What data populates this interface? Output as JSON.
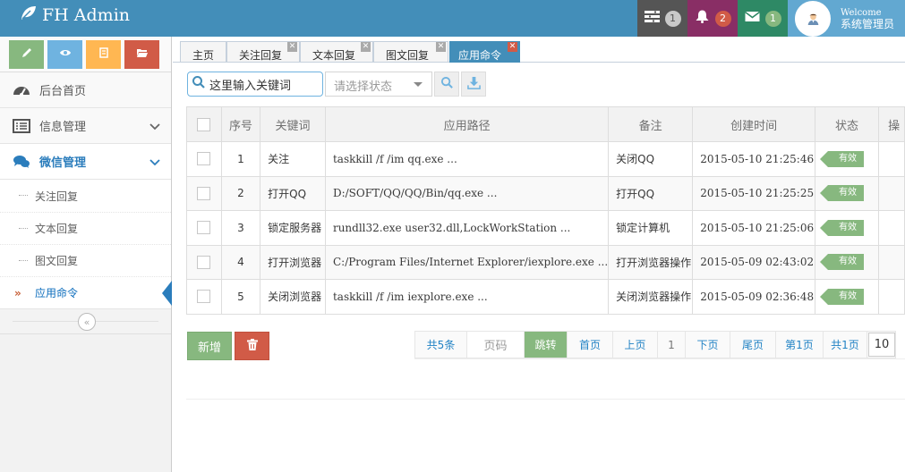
{
  "app": {
    "brand": "FH Admin"
  },
  "navbar": {
    "tasks_count": "1",
    "notifications_count": "2",
    "messages_count": "1",
    "welcome": "Welcome",
    "username": "系统管理员"
  },
  "sidebar": {
    "menu": [
      {
        "label": "后台首页",
        "icon": "tachometer-icon"
      },
      {
        "label": "信息管理",
        "icon": "list-alt-icon"
      },
      {
        "label": "微信管理",
        "icon": "comments-icon"
      }
    ],
    "submenu": [
      {
        "label": "关注回复"
      },
      {
        "label": "文本回复"
      },
      {
        "label": "图文回复"
      },
      {
        "label": "应用命令",
        "active": true
      }
    ],
    "collapse_glyph": "«"
  },
  "tabs": [
    {
      "label": "主页",
      "closable": false
    },
    {
      "label": "关注回复",
      "closable": true
    },
    {
      "label": "文本回复",
      "closable": true
    },
    {
      "label": "图文回复",
      "closable": true
    },
    {
      "label": "应用命令",
      "closable": true,
      "active": true
    }
  ],
  "toolbar": {
    "search_placeholder": "这里输入关键词",
    "status_placeholder": "请选择状态"
  },
  "table": {
    "headers": [
      "序号",
      "关键词",
      "应用路径",
      "备注",
      "创建时间",
      "状态",
      "操"
    ],
    "rows": [
      {
        "no": "1",
        "keyword": "关注",
        "path": "taskkill /f /im qq.exe ...",
        "note": "关闭QQ",
        "created": "2015-05-10 21:25:46",
        "status": "有效"
      },
      {
        "no": "2",
        "keyword": "打开QQ",
        "path": "D:/SOFT/QQ/QQ/Bin/qq.exe ...",
        "note": "打开QQ",
        "created": "2015-05-10 21:25:25",
        "status": "有效"
      },
      {
        "no": "3",
        "keyword": "锁定服务器",
        "path": "rundll32.exe user32.dll,LockWorkStation ...",
        "note": "锁定计算机",
        "created": "2015-05-10 21:25:06",
        "status": "有效"
      },
      {
        "no": "4",
        "keyword": "打开浏览器",
        "path": "C:/Program Files/Internet Explorer/iexplore.exe ...",
        "note": "打开浏览器操作",
        "created": "2015-05-09 02:43:02",
        "status": "有效"
      },
      {
        "no": "5",
        "keyword": "关闭浏览器",
        "path": "taskkill /f /im iexplore.exe ...",
        "note": "关闭浏览器操作",
        "created": "2015-05-09 02:36:48",
        "status": "有效"
      }
    ]
  },
  "actions": {
    "add_label": "新增"
  },
  "pager": {
    "total_prefix": "共",
    "total_count": "5",
    "total_suffix": "条",
    "page_input_placeholder": "页码",
    "go_label": "跳转",
    "first_label": "首页",
    "prev_label": "上页",
    "current_page": "1",
    "next_label": "下页",
    "last_label": "尾页",
    "page_of": "第1页",
    "total_pages": "共1页",
    "page_size": "10"
  },
  "colors": {
    "navbar": "#438eb9",
    "tasks": "#555555",
    "notifications": "#892e65",
    "messages": "#2e8965",
    "user": "#62a8d1",
    "success": "#87b87f",
    "danger": "#d15b47",
    "warning": "#ffb752",
    "info": "#6fb3e0"
  }
}
